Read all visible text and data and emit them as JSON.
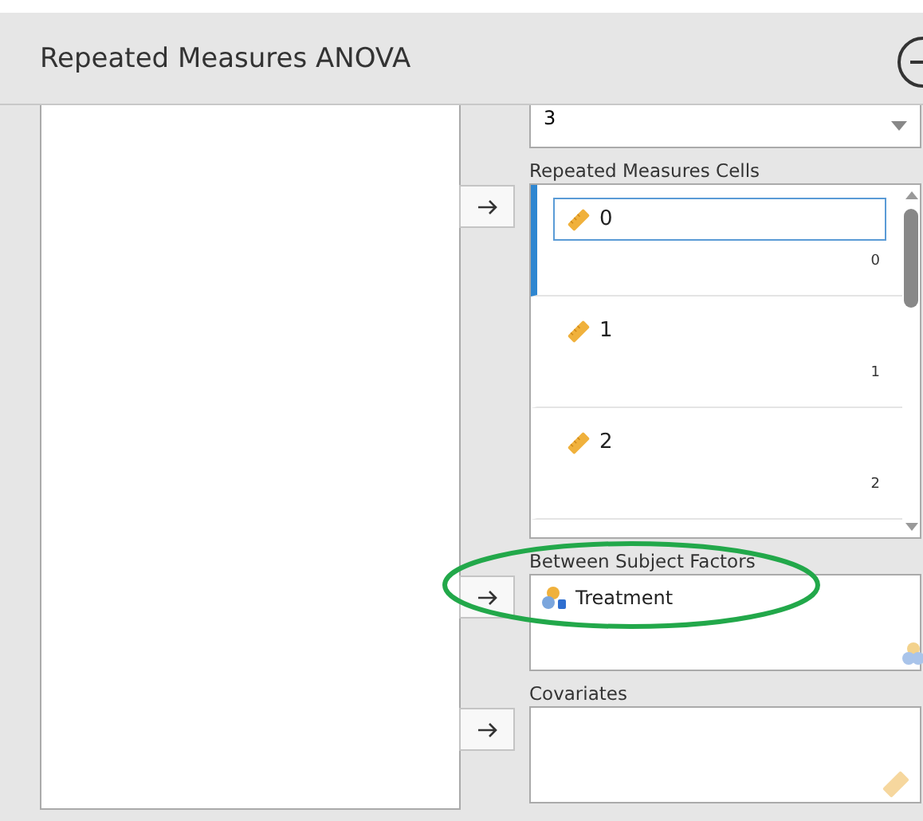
{
  "window": {
    "title": "Repeated Measures ANOVA"
  },
  "levels_field": {
    "value": "3"
  },
  "sections": [
    {
      "label": "Repeated Measures Cells",
      "kind": "cells",
      "items": [
        {
          "label": "0",
          "value": "0",
          "selected": true
        },
        {
          "label": "1",
          "value": "1",
          "selected": false
        },
        {
          "label": "2",
          "value": "2",
          "selected": false
        }
      ]
    },
    {
      "label": "Between Subject Factors",
      "kind": "factors",
      "highlighted": true,
      "items": [
        {
          "label": "Treatment",
          "selected": false
        }
      ]
    },
    {
      "label": "Covariates",
      "kind": "covariates"
    }
  ]
}
